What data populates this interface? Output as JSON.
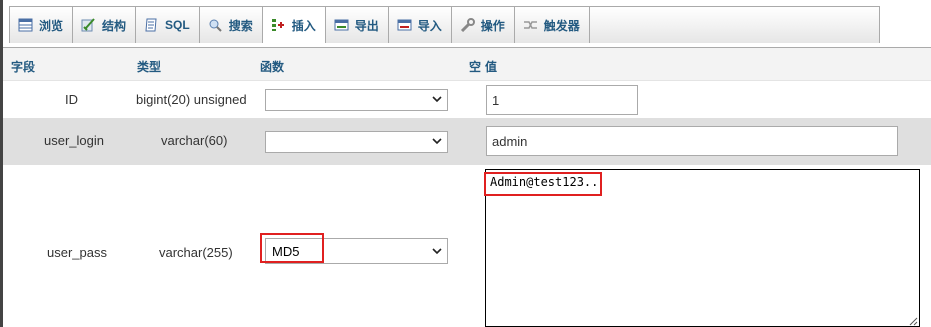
{
  "tabs": [
    {
      "label": "浏览",
      "icon": "browse-icon",
      "active": false
    },
    {
      "label": "结构",
      "icon": "structure-icon",
      "active": false
    },
    {
      "label": "SQL",
      "icon": "sql-icon",
      "active": false
    },
    {
      "label": "搜索",
      "icon": "search-icon",
      "active": false
    },
    {
      "label": "插入",
      "icon": "insert-icon",
      "active": true
    },
    {
      "label": "导出",
      "icon": "export-icon",
      "active": false
    },
    {
      "label": "导入",
      "icon": "import-icon",
      "active": false
    },
    {
      "label": "操作",
      "icon": "wrench-icon",
      "active": false
    },
    {
      "label": "触发器",
      "icon": "trigger-icon",
      "active": false
    }
  ],
  "header": {
    "field": "字段",
    "type": "类型",
    "function": "函数",
    "null": "空",
    "value": "值"
  },
  "rows": [
    {
      "field": "ID",
      "type": "bigint(20) unsigned",
      "function": "",
      "value": "1"
    },
    {
      "field": "user_login",
      "type": "varchar(60)",
      "function": "",
      "value": "admin"
    },
    {
      "field": "user_pass",
      "type": "varchar(255)",
      "function": "MD5",
      "value": "Admin@test123.."
    }
  ],
  "colors": {
    "link": "#235a81",
    "highlight": "#e02020",
    "alt_row": "#dfdfdf"
  }
}
